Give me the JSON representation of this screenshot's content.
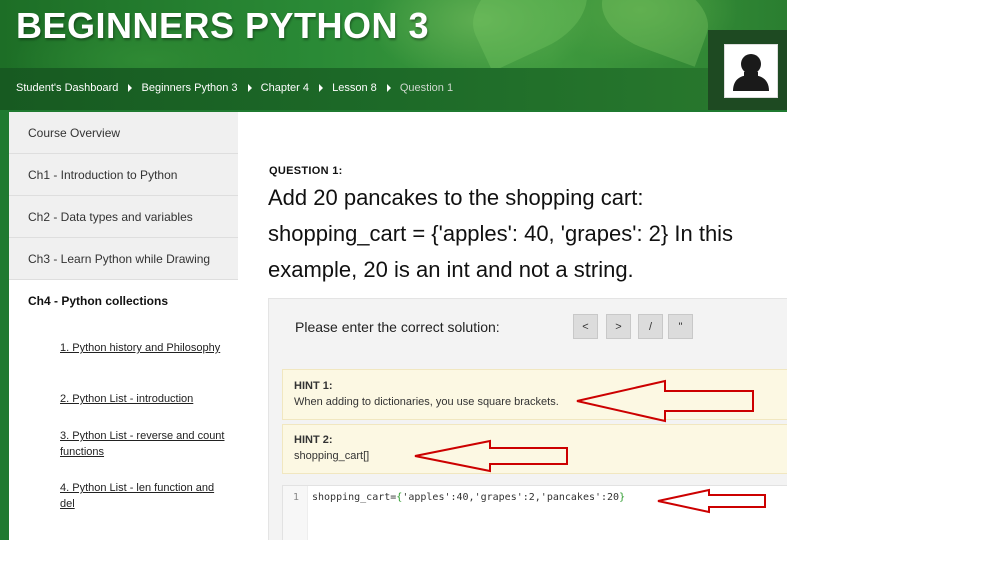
{
  "header": {
    "title": "BEGINNERS PYTHON 3"
  },
  "breadcrumb": [
    {
      "label": "Student's Dashboard"
    },
    {
      "label": "Beginners Python 3"
    },
    {
      "label": "Chapter 4"
    },
    {
      "label": "Lesson 8"
    },
    {
      "label": "Question 1"
    }
  ],
  "avatar": {
    "icon": "user-silhouette-icon"
  },
  "sidebar": {
    "items": [
      {
        "label": "Course Overview"
      },
      {
        "label": "Ch1 - Introduction to Python"
      },
      {
        "label": "Ch2 - Data types and variables"
      },
      {
        "label": "Ch3 - Learn Python while Drawing"
      }
    ],
    "active_chapter": "Ch4 - Python collections",
    "lessons": [
      {
        "label": "1. Python history and Philosophy"
      },
      {
        "label": "2. Python List - introduction"
      },
      {
        "label": "3. Python List - reverse and count functions"
      },
      {
        "label": "4. Python List - len function and del"
      }
    ]
  },
  "question": {
    "label": "QUESTION 1:",
    "text": "Add 20 pancakes to the shopping cart: shopping_cart = {'apples': 40, 'grapes': 2} In this example, 20 is an int and not a string."
  },
  "answer": {
    "prompt": "Please enter the correct solution:",
    "tools": [
      "<",
      ">",
      "/",
      "\""
    ]
  },
  "hints": [
    {
      "title": "HINT 1:",
      "text": "When adding to dictionaries, you use square brackets."
    },
    {
      "title": "HINT 2:",
      "text": "shopping_cart[]"
    }
  ],
  "editor": {
    "line_number": "1",
    "code_prefix": "shopping_cart=",
    "code_open": "{",
    "code_body": "'apples':40,'grapes':2,'pancakes':20",
    "code_close": "}"
  },
  "colors": {
    "header_green": "#1d6e26",
    "hint_background": "#fcf8e3",
    "annotation_arrow": "#cc0000"
  }
}
